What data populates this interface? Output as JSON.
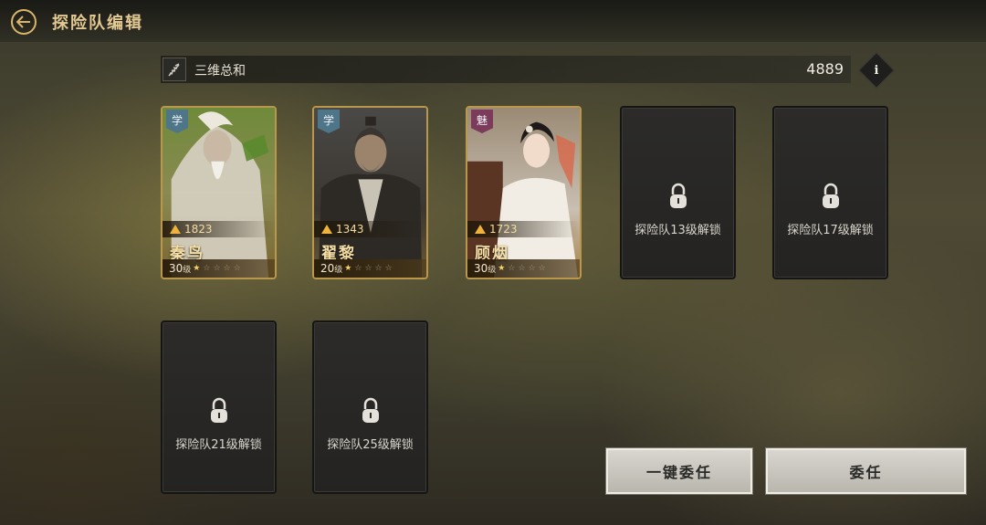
{
  "header": {
    "title": "探险队编辑"
  },
  "stats": {
    "label": "三维总和",
    "value": "4889"
  },
  "info_icon": "i",
  "heroes": [
    {
      "badge": "学",
      "power": "1823",
      "name": "秦鸟",
      "level": "30",
      "level_suffix": "级",
      "stars": 1,
      "max_stars": 5
    },
    {
      "badge": "学",
      "power": "1343",
      "name": "翟黎",
      "level": "20",
      "level_suffix": "级",
      "stars": 1,
      "max_stars": 5
    },
    {
      "badge": "魅",
      "power": "1723",
      "name": "顾烟",
      "level": "30",
      "level_suffix": "级",
      "stars": 1,
      "max_stars": 5
    }
  ],
  "locked_slots": [
    {
      "text": "探险队13级解锁"
    },
    {
      "text": "探险队17级解锁"
    },
    {
      "text": "探险队21级解锁"
    },
    {
      "text": "探险队25级解锁"
    }
  ],
  "buttons": {
    "auto_assign": "一键委任",
    "assign": "委任"
  },
  "colors": {
    "accent_gold": "#e2c891",
    "card_border": "#b9974c",
    "badge_xue": "#4f7688",
    "badge_mei": "#7c3b5b"
  }
}
